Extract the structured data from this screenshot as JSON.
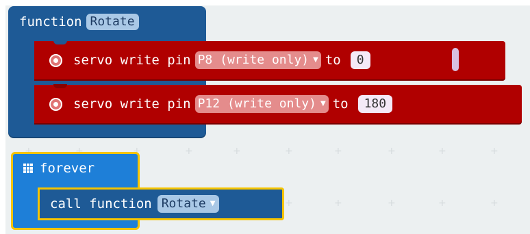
{
  "function_block": {
    "keyword": "function",
    "name": "Rotate"
  },
  "servo_blocks": [
    {
      "label": "servo write pin",
      "pin": "P8 (write only)",
      "to_label": "to",
      "value": "0"
    },
    {
      "label": "servo write pin",
      "pin": "P12 (write only)",
      "to_label": "to",
      "value": "180"
    }
  ],
  "forever_block": {
    "label": "forever"
  },
  "call_block": {
    "label": "call function",
    "function_name": "Rotate"
  },
  "icons": {
    "servo": "servo-icon",
    "dropdown": "dropdown-arrow-icon",
    "forever": "grid-icon"
  },
  "colors": {
    "function_block": "#1e5a96",
    "servo_block": "#b00000",
    "forever_block": "#1e7fd8",
    "highlight": "#f5c400",
    "workspace": "#ecf0f1"
  }
}
